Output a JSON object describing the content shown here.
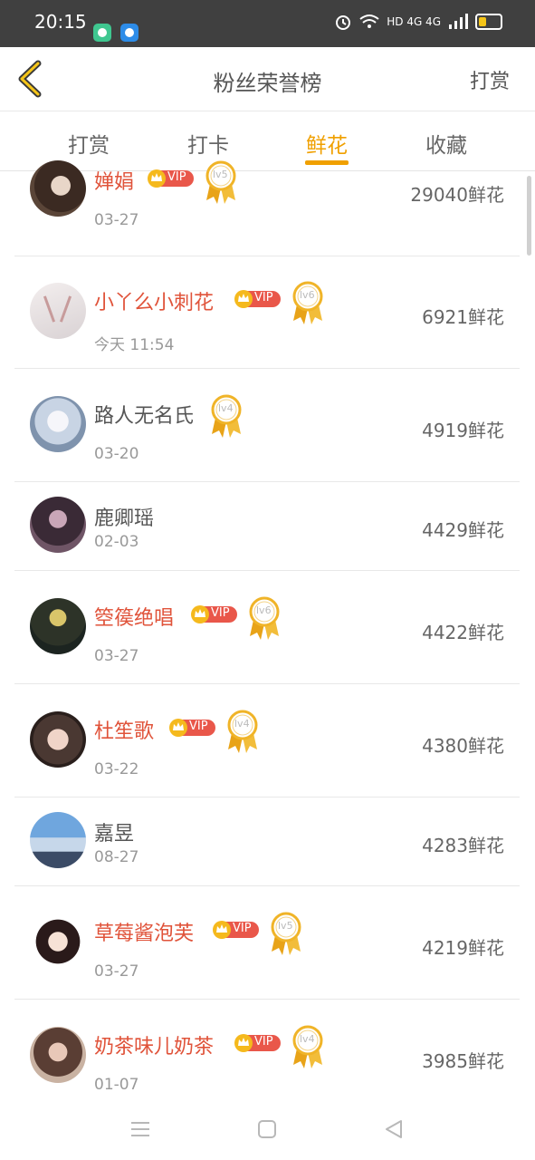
{
  "status_bar": {
    "time": "20:15",
    "indicators": "HD 4G 4G"
  },
  "header": {
    "title": "粉丝荣誉榜",
    "right_action": "打赏",
    "back_icon": "back-chevron-icon"
  },
  "tabs": [
    {
      "label": "打赏",
      "active": false
    },
    {
      "label": "打卡",
      "active": false
    },
    {
      "label": "鲜花",
      "active": true
    },
    {
      "label": "收藏",
      "active": false
    }
  ],
  "colors": {
    "accent": "#f0a000",
    "vip_name": "#e0533a",
    "normal_name": "#555555"
  },
  "list": [
    {
      "name": "婵娟",
      "vip": true,
      "vip_label": "VIP",
      "level": "lv5",
      "date": "03-27",
      "score": "29040鲜花"
    },
    {
      "name": "小丫么小刺花",
      "vip": true,
      "vip_label": "VIP",
      "level": "lv6",
      "date": "今天 11:54",
      "score": "6921鲜花"
    },
    {
      "name": "路人无名氏",
      "vip": false,
      "level": "lv4",
      "date": "03-20",
      "score": "4919鲜花"
    },
    {
      "name": "鹿卿瑶",
      "vip": false,
      "level": "",
      "date": "02-03",
      "score": "4429鲜花"
    },
    {
      "name": "箜篌绝唱",
      "vip": true,
      "vip_label": "VIP",
      "level": "lv6",
      "date": "03-27",
      "score": "4422鲜花"
    },
    {
      "name": "杜笙歌",
      "vip": true,
      "vip_label": "VIP",
      "level": "lv4",
      "date": "03-22",
      "score": "4380鲜花"
    },
    {
      "name": "嘉昱",
      "vip": false,
      "level": "",
      "date": "08-27",
      "score": "4283鲜花"
    },
    {
      "name": "草莓酱泡芙",
      "vip": true,
      "vip_label": "VIP",
      "level": "lv5",
      "date": "03-27",
      "score": "4219鲜花"
    },
    {
      "name": "奶茶味儿奶茶",
      "vip": true,
      "vip_label": "VIP",
      "level": "lv4",
      "date": "01-07",
      "score": "3985鲜花"
    }
  ],
  "nav_bar": {
    "menu_icon": "menu-icon",
    "home_icon": "home-square-icon",
    "back_icon": "back-triangle-icon"
  }
}
